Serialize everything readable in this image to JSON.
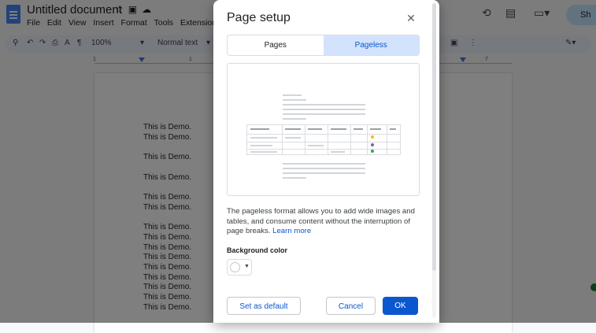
{
  "app": {
    "doc_title": "Untitled document",
    "menus": [
      "File",
      "Edit",
      "View",
      "Insert",
      "Format",
      "Tools",
      "Extensions"
    ],
    "toolbar": {
      "zoom": "100%",
      "style": "Normal text"
    },
    "share_label": "Sh",
    "ruler": {
      "n1": "1",
      "n7": "7"
    },
    "document_lines": [
      "This is Demo.",
      "This is Demo.",
      "This is Demo.",
      "This is Demo.",
      "This is Demo.",
      "This is Demo.",
      "This is Demo.",
      "This is Demo.",
      "This is Demo.",
      "This is Demo.",
      "This is Demo.",
      "This is Demo.",
      "This is Demo.",
      "This is Demo.",
      "This is Demo."
    ]
  },
  "dialog": {
    "title": "Page setup",
    "close_icon": "close-icon",
    "tabs": [
      {
        "label": "Pages",
        "active": false
      },
      {
        "label": "Pageless",
        "active": true
      }
    ],
    "description": "The pageless format allows you to add wide images and tables, and consume content without the interruption of page breaks.",
    "learn_more": "Learn more",
    "background_color_label": "Background color",
    "background_color": "#ffffff",
    "buttons": {
      "set_default": "Set as default",
      "cancel": "Cancel",
      "ok": "OK"
    }
  },
  "colors": {
    "accent": "#0b57d0",
    "tab_active_bg": "#d3e3fd",
    "scrim": "rgba(0,0,0,0.5)"
  }
}
